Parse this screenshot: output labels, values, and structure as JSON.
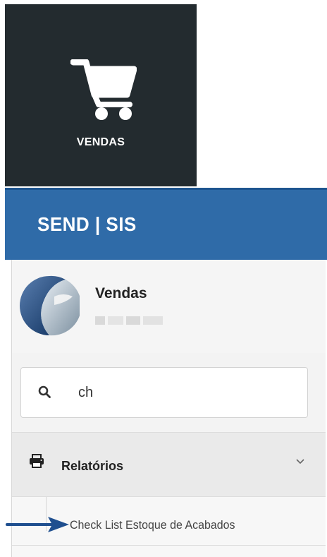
{
  "tile": {
    "label": "VENDAS",
    "icon": "shopping-cart-icon"
  },
  "header": {
    "brand": "SEND | SIS"
  },
  "profile": {
    "name": "Vendas",
    "logo": "company-logo"
  },
  "search": {
    "value": "ch",
    "icon": "search-icon"
  },
  "menu": {
    "section_label": "Relatórios",
    "section_icon": "printer-icon",
    "expand_icon": "chevron-down-icon",
    "items": [
      {
        "label": "Check List Estoque de Acabados"
      }
    ]
  },
  "annotation": {
    "icon": "arrow-right-icon",
    "color": "#1f4f8f"
  },
  "colors": {
    "tile_bg": "#232b2f",
    "header_bg": "#2f6ba8",
    "sidebar_bg": "#f3f3f3"
  }
}
